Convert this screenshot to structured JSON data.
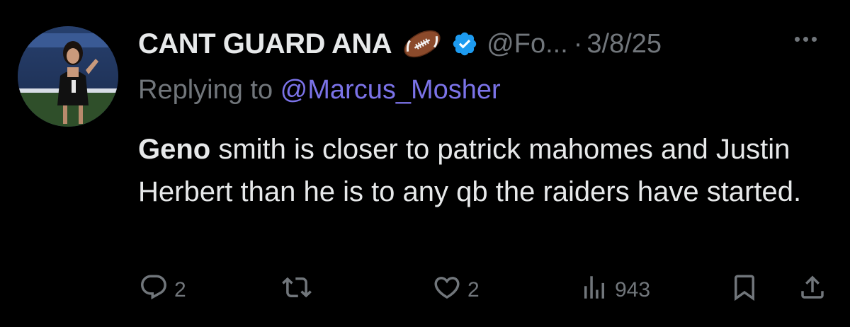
{
  "tweet": {
    "display_name": "CANT GUARD ANA",
    "handle": "@Fo...",
    "separator": "·",
    "date": "3/8/25",
    "reply_prefix": "Replying to ",
    "reply_mention": "@Marcus_Mosher",
    "body_bold": "Geno",
    "body_rest": " smith is closer to patrick mahomes and Justin Herbert than he is to any qb the raiders have started."
  },
  "actions": {
    "reply_count": "2",
    "retweet_count": "",
    "like_count": "2",
    "views_count": "943"
  },
  "icons": {
    "emoji": "american-football-icon",
    "verified": "verified-badge-icon",
    "more": "more-dots-icon",
    "reply": "reply-icon",
    "retweet": "retweet-icon",
    "like": "heart-icon",
    "views": "views-bar-chart-icon",
    "bookmark": "bookmark-icon",
    "share": "share-icon"
  },
  "colors": {
    "background": "#000000",
    "text": "#e7e9ea",
    "muted": "#71767b",
    "mention": "#7b73e8",
    "verified": "#1d9bf0"
  }
}
